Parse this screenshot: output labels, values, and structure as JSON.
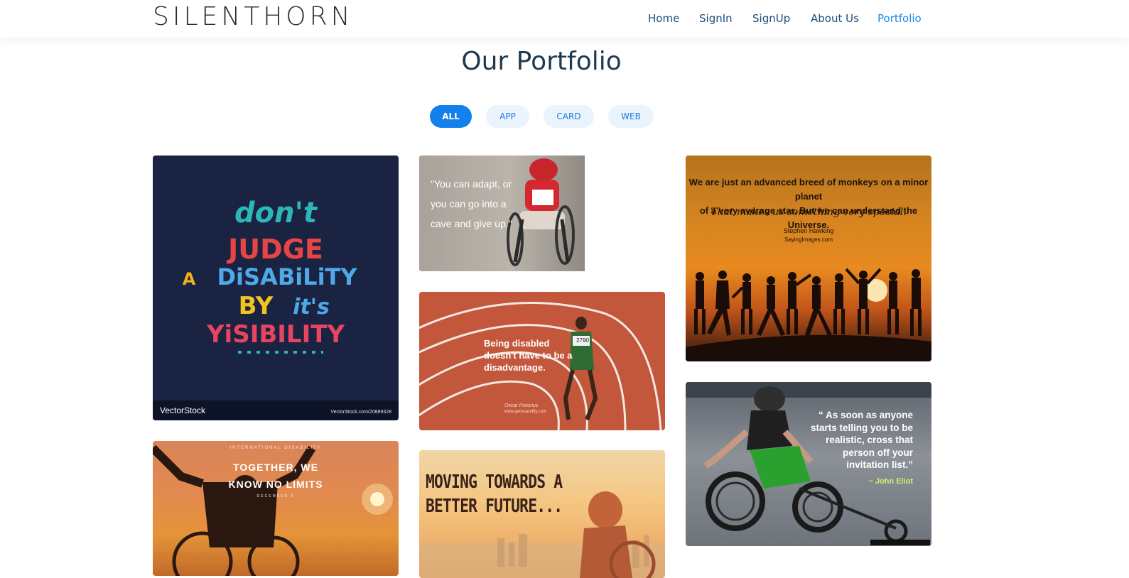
{
  "header": {
    "logo": "SILENTHORN",
    "nav": [
      "Home",
      "SignIn",
      "SignUp",
      "About Us",
      "Portfolio"
    ],
    "active_nav": "Portfolio"
  },
  "section": {
    "title": "Our Portfolio"
  },
  "filters": [
    "ALL",
    "APP",
    "CARD",
    "WEB"
  ],
  "active_filter": "ALL",
  "tiles": {
    "poster": {
      "lines": [
        "don't",
        "JUDGE",
        "A",
        "DiSABiLiTY",
        "BY",
        "it's",
        "YiSIBILITY"
      ],
      "brand": "VectorStock",
      "url": "VectorStock.com/20889328"
    },
    "adapt": {
      "quote": "\"You can adapt, or you can go into a cave and give up.\""
    },
    "track": {
      "quote": "Being disabled doesn't have to be a disadvantage.",
      "author": "Oscar Pistorius",
      "site": "www.geckoandfly.com",
      "bib": "2790"
    },
    "hawking": {
      "quote_line1": "We are just an advanced breed of monkeys on a minor planet",
      "quote_line2": "of a very average star. But we can understand the Universe.",
      "quote_line3": "That makes us something very special.",
      "author": "Stephen Hawking",
      "site": "SayingImages.com"
    },
    "racer": {
      "quote": "“ As soon as anyone starts telling you to be realistic, cross that person off your invitation list.”",
      "author": "~ John Eliot"
    },
    "together": {
      "top": "INTERNATIONAL DISABILITY",
      "quote": "TOGETHER, WE KNOW NO LIMITS",
      "bottom": "DECEMBER 3"
    },
    "moving": {
      "quote": "MOVING TOWARDS A BETTER FUTURE..."
    }
  }
}
